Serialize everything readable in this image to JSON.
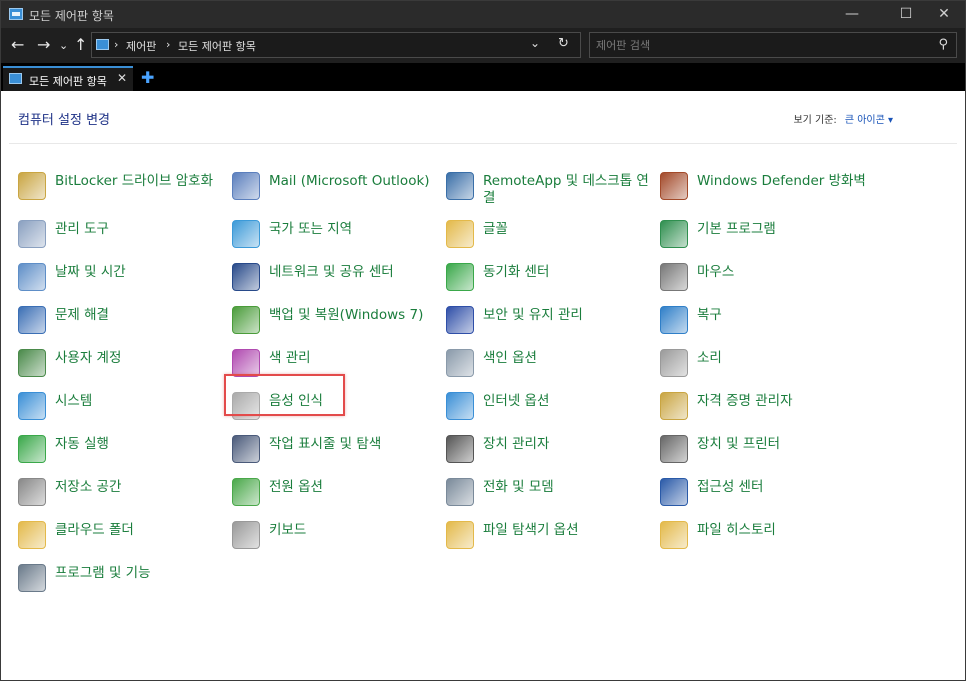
{
  "window": {
    "title": "모든 제어판 항목",
    "minimize": "—",
    "maximize": "☐",
    "close": "✕"
  },
  "nav": {
    "back": "←",
    "forward": "→",
    "dropdown": "⌄",
    "up": "↑",
    "breadcrumb": [
      "제어판",
      "모든 제어판 항목"
    ],
    "separator": "›",
    "address_dropdown": "⌄",
    "refresh": "↻",
    "search_placeholder": "제어판 검색",
    "search_icon": "⚲"
  },
  "tabs": {
    "active_label": "모든 제어판 항목",
    "close": "✕",
    "add": "✚"
  },
  "content": {
    "heading": "컴퓨터 설정 변경",
    "view_by_label": "보기 기준:",
    "view_by_value": "큰 아이콘 ▾",
    "highlighted_item": "전원 옵션",
    "items": [
      {
        "label": "BitLocker 드라이브 암호화",
        "icon": "bitlocker-icon",
        "color": "#c9a542"
      },
      {
        "label": "Mail (Microsoft Outlook)",
        "icon": "mail-icon",
        "color": "#5b7fbd"
      },
      {
        "label": "RemoteApp 및 데스크톱 연결",
        "icon": "remoteapp-icon",
        "color": "#3a6fa8"
      },
      {
        "label": "Windows Defender 방화벽",
        "icon": "firewall-icon",
        "color": "#a34a2a"
      },
      {
        "label": "관리 도구",
        "icon": "admin-tools-icon",
        "color": "#8aa0c0"
      },
      {
        "label": "국가 또는 지역",
        "icon": "globe-clock-icon",
        "color": "#3c9ad8"
      },
      {
        "label": "글꼴",
        "icon": "fonts-icon",
        "color": "#e3b94a"
      },
      {
        "label": "기본 프로그램",
        "icon": "default-programs-icon",
        "color": "#2f8f4f"
      },
      {
        "label": "날짜 및 시간",
        "icon": "calendar-clock-icon",
        "color": "#5e8ec7"
      },
      {
        "label": "네트워크 및 공유 센터",
        "icon": "network-icon",
        "color": "#284a8a"
      },
      {
        "label": "동기화 센터",
        "icon": "sync-icon",
        "color": "#3aa84a"
      },
      {
        "label": "마우스",
        "icon": "mouse-icon",
        "color": "#777777"
      },
      {
        "label": "문제 해결",
        "icon": "troubleshoot-icon",
        "color": "#3b6fb5"
      },
      {
        "label": "백업 및 복원(Windows 7)",
        "icon": "backup-icon",
        "color": "#4a9c3a"
      },
      {
        "label": "보안 및 유지 관리",
        "icon": "flag-icon",
        "color": "#2f4fa8"
      },
      {
        "label": "복구",
        "icon": "recovery-icon",
        "color": "#2f7fc8"
      },
      {
        "label": "사용자 계정",
        "icon": "users-icon",
        "color": "#4a8a4a"
      },
      {
        "label": "색 관리",
        "icon": "color-management-icon",
        "color": "#b04ab0"
      },
      {
        "label": "색인 옵션",
        "icon": "indexing-icon",
        "color": "#8a9aaa"
      },
      {
        "label": "소리",
        "icon": "speaker-icon",
        "color": "#9a9a9a"
      },
      {
        "label": "시스템",
        "icon": "system-icon",
        "color": "#3a8fd6"
      },
      {
        "label": "음성 인식",
        "icon": "microphone-icon",
        "color": "#aaaaaa"
      },
      {
        "label": "인터넷 옵션",
        "icon": "internet-options-icon",
        "color": "#3a8fd6"
      },
      {
        "label": "자격 증명 관리자",
        "icon": "credential-icon",
        "color": "#c9a542"
      },
      {
        "label": "자동 실행",
        "icon": "autoplay-icon",
        "color": "#3aa84a"
      },
      {
        "label": "작업 표시줄 및 탐색",
        "icon": "taskbar-icon",
        "color": "#4a5a7a"
      },
      {
        "label": "장치 관리자",
        "icon": "device-manager-icon",
        "color": "#555555"
      },
      {
        "label": "장치 및 프린터",
        "icon": "printer-icon",
        "color": "#666666"
      },
      {
        "label": "저장소 공간",
        "icon": "storage-icon",
        "color": "#888888"
      },
      {
        "label": "전원 옵션",
        "icon": "power-options-icon",
        "color": "#4aa84a"
      },
      {
        "label": "전화 및 모뎀",
        "icon": "phone-modem-icon",
        "color": "#7a8a9a"
      },
      {
        "label": "접근성 센터",
        "icon": "accessibility-icon",
        "color": "#2a5aa8"
      },
      {
        "label": "클라우드 폴더",
        "icon": "cloud-folder-icon",
        "color": "#e3b94a"
      },
      {
        "label": "키보드",
        "icon": "keyboard-icon",
        "color": "#999999"
      },
      {
        "label": "파일 탐색기 옵션",
        "icon": "folder-options-icon",
        "color": "#e3b94a"
      },
      {
        "label": "파일 히스토리",
        "icon": "file-history-icon",
        "color": "#e3b94a"
      },
      {
        "label": "프로그램 및 기능",
        "icon": "programs-features-icon",
        "color": "#6a7a8a"
      }
    ]
  }
}
